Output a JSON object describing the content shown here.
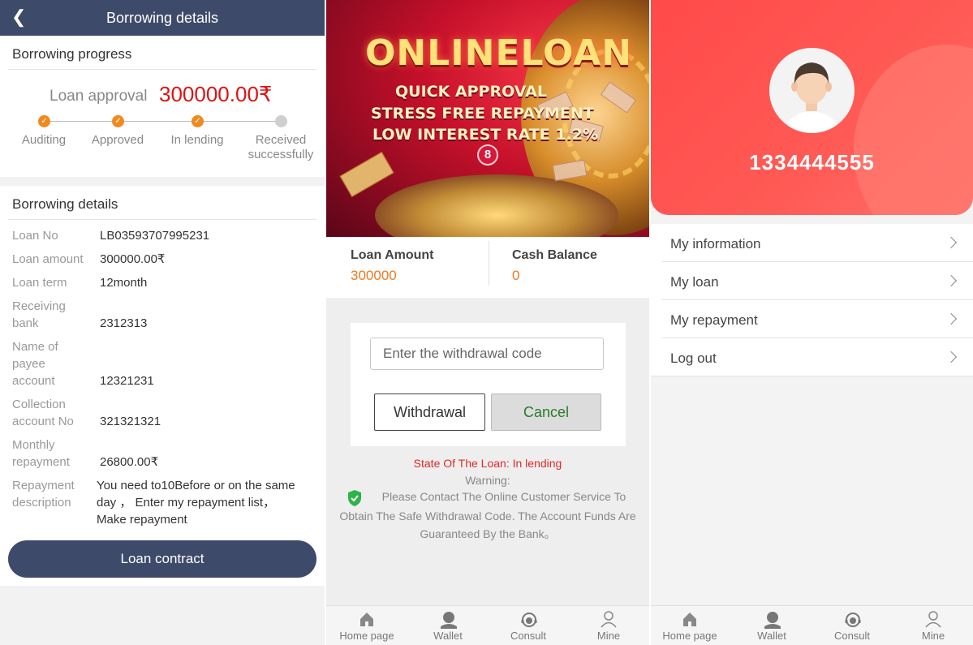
{
  "details": {
    "header": {
      "title": "Borrowing details"
    },
    "progress": {
      "section_title": "Borrowing progress",
      "approval_label": "Loan approval",
      "approval_amount": "300000.00₹",
      "steps": [
        {
          "label": "Auditing",
          "done": true
        },
        {
          "label": "Approved",
          "done": true
        },
        {
          "label": "In lending",
          "done": true
        },
        {
          "label_line1": "Received",
          "label_line2": "successfully",
          "done": false
        }
      ]
    },
    "section_title": "Borrowing details",
    "rows": {
      "loan_no": {
        "label": "Loan No",
        "value": "LB03593707995231"
      },
      "loan_amount": {
        "label": "Loan amount",
        "value": "300000.00₹"
      },
      "loan_term": {
        "label": "Loan term",
        "value": "12month"
      },
      "receiving_bank": {
        "label1": "Receiving",
        "label2": "bank",
        "value": "2312313"
      },
      "payee_name": {
        "label1": "Name of",
        "label2": "payee",
        "label3": "account",
        "value": "12321231"
      },
      "collection_account": {
        "label1": "Collection",
        "label2": "account No",
        "value": "321321321"
      },
      "monthly_repayment": {
        "label1": "Monthly",
        "label2": "repayment",
        "value": "26800.00₹"
      },
      "repayment_description": {
        "label1": "Repayment",
        "label2": "description",
        "line1": "You need to10Before or on the same",
        "line2": "day ， Enter my repayment list，",
        "line3": "Make repayment"
      }
    },
    "contract_button": "Loan contract"
  },
  "wallet": {
    "banner": {
      "title": "ONLINELOAN",
      "line1": "QUICK APPROVAL",
      "line2": "STRESS FREE REPAYMENT",
      "line3": "LOW INTEREST RATE 1.2%",
      "badge": "8"
    },
    "loan_amount": {
      "label": "Loan Amount",
      "value": "300000"
    },
    "cash_balance": {
      "label": "Cash Balance",
      "value": "0"
    },
    "withdrawal_placeholder": "Enter the withdrawal code",
    "withdraw_button": "Withdrawal",
    "cancel_button": "Cancel",
    "state": "State Of The Loan:   In lending",
    "warning_title": "Warning:",
    "warning_line1": "Please Contact The Online Customer Service To",
    "warning_line2": "Obtain The Safe Withdrawal Code. The Account Funds Are",
    "warning_line3": "Guaranteed By the Bank。"
  },
  "profile": {
    "phone": "1334444555",
    "menu": [
      {
        "label": "My information"
      },
      {
        "label": "My loan"
      },
      {
        "label": "My repayment"
      },
      {
        "label": "Log out"
      }
    ]
  },
  "tabbar": {
    "home": "Home page",
    "wallet": "Wallet",
    "consult": "Consult",
    "mine": "Mine"
  },
  "colors": {
    "header": "#3e4a69",
    "accent_orange": "#f08a1e",
    "amount_red": "#e01212",
    "hero_red": "#ff4a4a"
  },
  "icons": [
    "back-arrow-icon",
    "shield-check-icon",
    "home-icon",
    "wallet-icon",
    "consult-icon",
    "mine-icon",
    "chevron-right-icon",
    "avatar-icon"
  ]
}
